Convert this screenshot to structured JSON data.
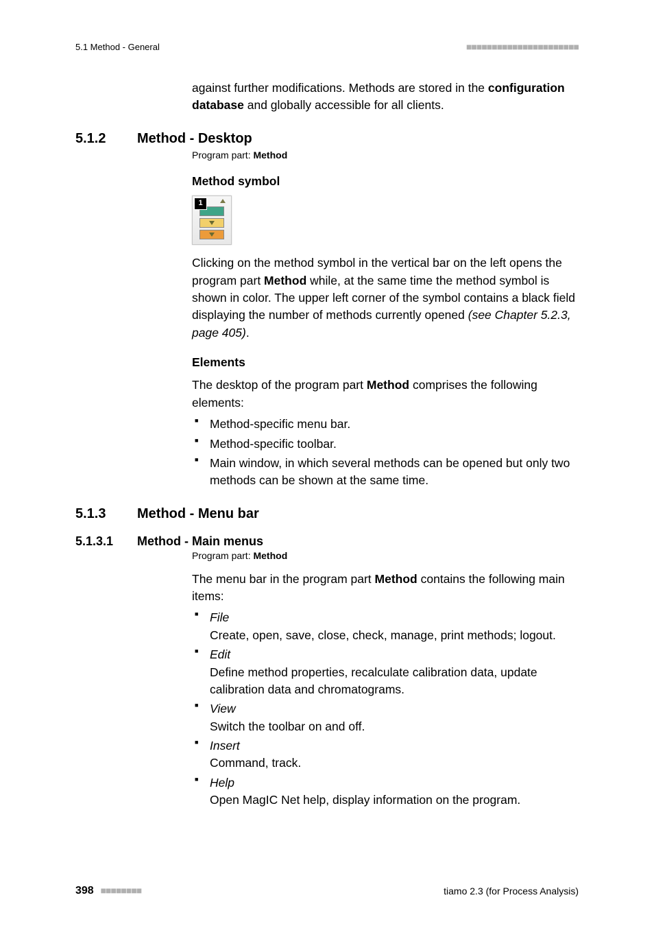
{
  "header": {
    "left": "5.1 Method - General",
    "dashes": "■■■■■■■■■■■■■■■■■■■■■■"
  },
  "intro": {
    "p1a": "against further modifications. Methods are stored in the ",
    "p1b": "configuration database",
    "p1c": " and globally accessible for all clients."
  },
  "sec512": {
    "num": "5.1.2",
    "title": "Method - Desktop",
    "prog_label": "Program part: ",
    "prog_val": "Method",
    "h_symbol": "Method symbol",
    "icon_badge": "1",
    "p2a": "Clicking on the method symbol in the vertical bar on the left opens the program part ",
    "p2b": "Method",
    "p2c": " while, at the same time the method symbol is shown in color. The upper left corner of the symbol contains a black field displaying the number of methods currently opened ",
    "p2d": "(see Chapter 5.2.3, page 405)",
    "p2e": ".",
    "h_elements": "Elements",
    "elements_intro_a": "The desktop of the program part ",
    "elements_intro_b": "Method",
    "elements_intro_c": " comprises the following elements:",
    "el": [
      "Method-specific menu bar.",
      "Method-specific toolbar.",
      "Main window, in which several methods can be opened but only two methods can be shown at the same time."
    ]
  },
  "sec513": {
    "num": "5.1.3",
    "title": "Method - Menu bar"
  },
  "sec5131": {
    "num": "5.1.3.1",
    "title": "Method - Main menus",
    "prog_label": "Program part: ",
    "prog_val": "Method",
    "intro_a": "The menu bar in the program part ",
    "intro_b": "Method",
    "intro_c": " contains the following main items:",
    "menus": [
      {
        "name": "File",
        "desc": "Create, open, save, close, check, manage, print methods; logout."
      },
      {
        "name": "Edit",
        "desc": "Define method properties, recalculate calibration data, update calibration data and chromatograms."
      },
      {
        "name": "View",
        "desc": "Switch the toolbar on and off."
      },
      {
        "name": "Insert",
        "desc": "Command, track."
      },
      {
        "name": "Help",
        "desc": "Open MagIC Net help, display information on the program."
      }
    ]
  },
  "footer": {
    "page": "398",
    "dashes": "■■■■■■■■",
    "right": "tiamo 2.3 (for Process Analysis)"
  }
}
